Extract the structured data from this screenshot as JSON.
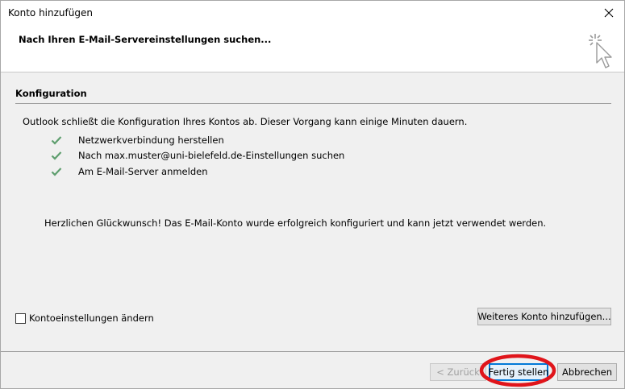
{
  "window": {
    "title": "Konto hinzufügen"
  },
  "header": {
    "title": "Nach Ihren E-Mail-Servereinstellungen suchen..."
  },
  "section": {
    "title": "Konfiguration",
    "intro": "Outlook schließt die Konfiguration Ihres Kontos ab. Dieser Vorgang kann einige Minuten dauern.",
    "steps": [
      {
        "label": "Netzwerkverbindung herstellen",
        "status": "done"
      },
      {
        "label": "Nach max.muster@uni-bielefeld.de-Einstellungen suchen",
        "status": "done"
      },
      {
        "label": "Am E-Mail-Server anmelden",
        "status": "done"
      }
    ],
    "success_message": "Herzlichen Glückwunsch! Das E-Mail-Konto wurde erfolgreich konfiguriert und kann jetzt verwendet werden."
  },
  "options": {
    "change_settings_label": "Kontoeinstellungen ändern",
    "change_settings_checked": false,
    "add_another_label": "Weiteres Konto hinzufügen..."
  },
  "footer": {
    "back_label": "< Zurück",
    "finish_label": "Fertig stellen",
    "cancel_label": "Abbrechen"
  },
  "colors": {
    "check": "#5e9e6e",
    "annotation": "#e0151b",
    "focus": "#0078d7"
  },
  "icons": {
    "close": "close-icon",
    "header": "cursor-click-icon",
    "check": "check-icon"
  }
}
